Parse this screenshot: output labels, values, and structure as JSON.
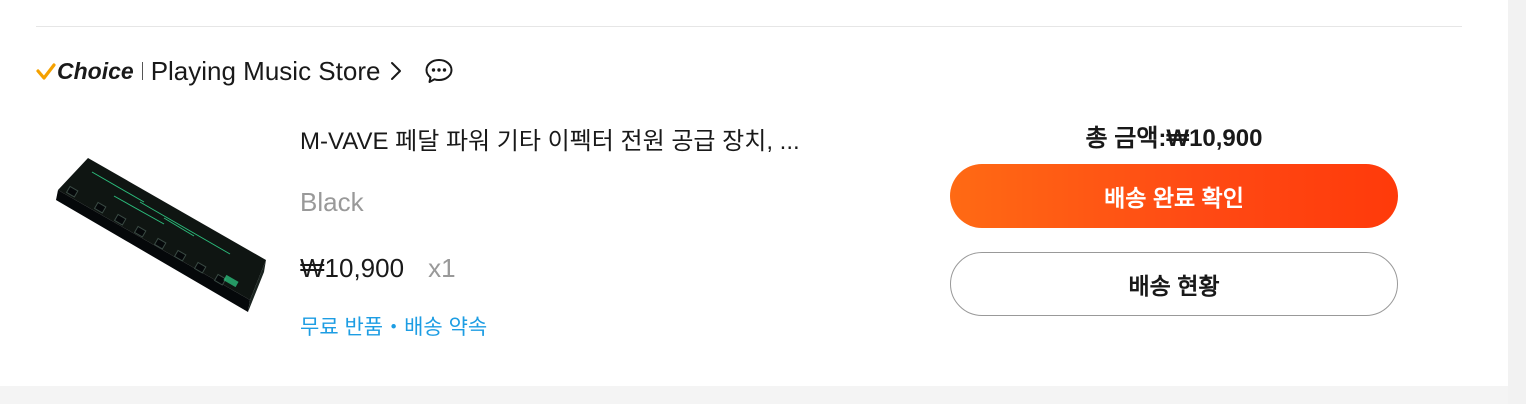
{
  "store": {
    "badge": "Choice",
    "name": "Playing Music Store",
    "badge_color": "#f5a100",
    "icons": [
      "checkmark-icon",
      "chevron-right-icon",
      "chat-icon"
    ]
  },
  "product": {
    "title": "M-VAVE 페달 파워 기타 이펙터 전원 공급 장치, ...",
    "variant": "Black",
    "price": "₩10,900",
    "quantity": "x1",
    "promo": "무료 반품・배송 약속"
  },
  "order": {
    "total_label": "총 금액:₩10,900",
    "confirm_label": "배송 완료 확인",
    "track_label": "배송 현황",
    "accent_color": "#ff4e12",
    "promo_color": "#1d9de3"
  }
}
